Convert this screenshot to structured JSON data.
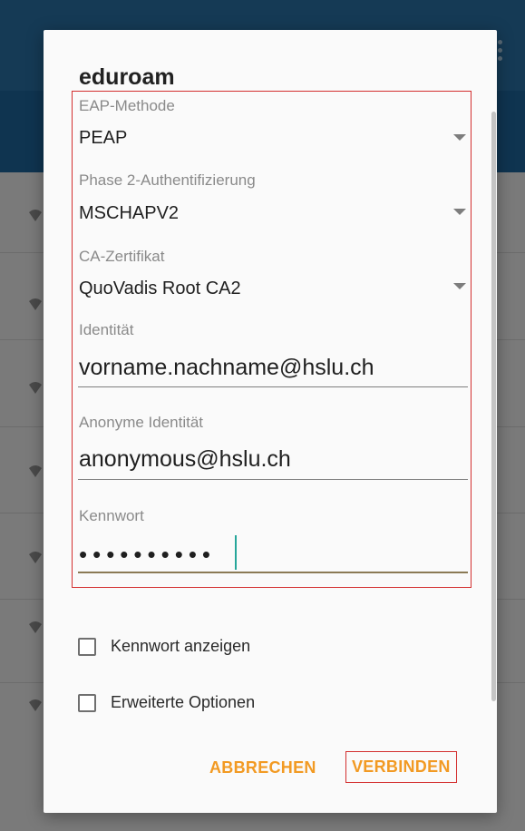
{
  "dialog": {
    "title": "eduroam",
    "eap_method": {
      "label": "EAP-Methode",
      "value": "PEAP"
    },
    "phase2_auth": {
      "label": "Phase 2-Authentifizierung",
      "value": "MSCHAPV2"
    },
    "ca_cert": {
      "label": "CA-Zertifikat",
      "value": "QuoVadis Root CA2"
    },
    "identity": {
      "label": "Identität",
      "value": "vorname.nachname@hslu.ch"
    },
    "anonymous_identity": {
      "label": "Anonyme Identität",
      "value": "anonymous@hslu.ch"
    },
    "password": {
      "label": "Kennwort",
      "value": "••••••••••"
    },
    "show_password": {
      "label": "Kennwort anzeigen",
      "checked": false
    },
    "advanced_options": {
      "label": "Erweiterte Optionen",
      "checked": false
    },
    "buttons": {
      "cancel": "ABBRECHEN",
      "connect": "VERBINDEN"
    }
  },
  "colors": {
    "accent": "#f29a23",
    "highlight": "#d32f2f",
    "cursor": "#26a69a"
  },
  "icons": [
    "wifi-icon",
    "chevron-down-icon",
    "overflow-menu-icon"
  ]
}
